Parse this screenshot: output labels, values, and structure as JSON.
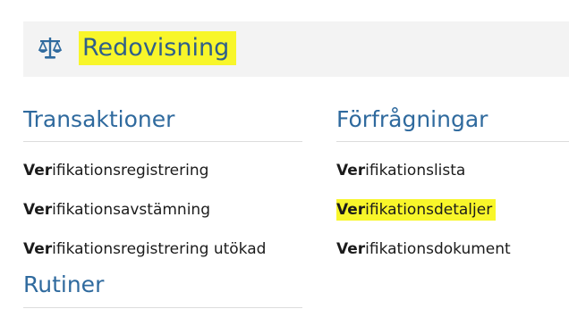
{
  "header": {
    "title": "Redovisning",
    "icon": "scales-icon",
    "title_color": "#2f5f8a",
    "highlight_color": "#f8f62a"
  },
  "search_match": "Ver",
  "sections": {
    "transaktioner": {
      "heading": "Transaktioner",
      "items": [
        {
          "match": "Ver",
          "rest": "ifikationsregistrering"
        },
        {
          "match": "Ver",
          "rest": "ifikationsavstämning"
        },
        {
          "match": "Ver",
          "rest": "ifikationsregistrering utökad"
        }
      ]
    },
    "forfragningar": {
      "heading": "Förfrågningar",
      "items": [
        {
          "match": "Ver",
          "rest": "ifikationslista"
        },
        {
          "match": "Ver",
          "rest": "ifikationsdetaljer",
          "highlighted": true
        },
        {
          "match": "Ver",
          "rest": "ifikationsdokument"
        }
      ]
    },
    "rutiner": {
      "heading": "Rutiner"
    }
  }
}
